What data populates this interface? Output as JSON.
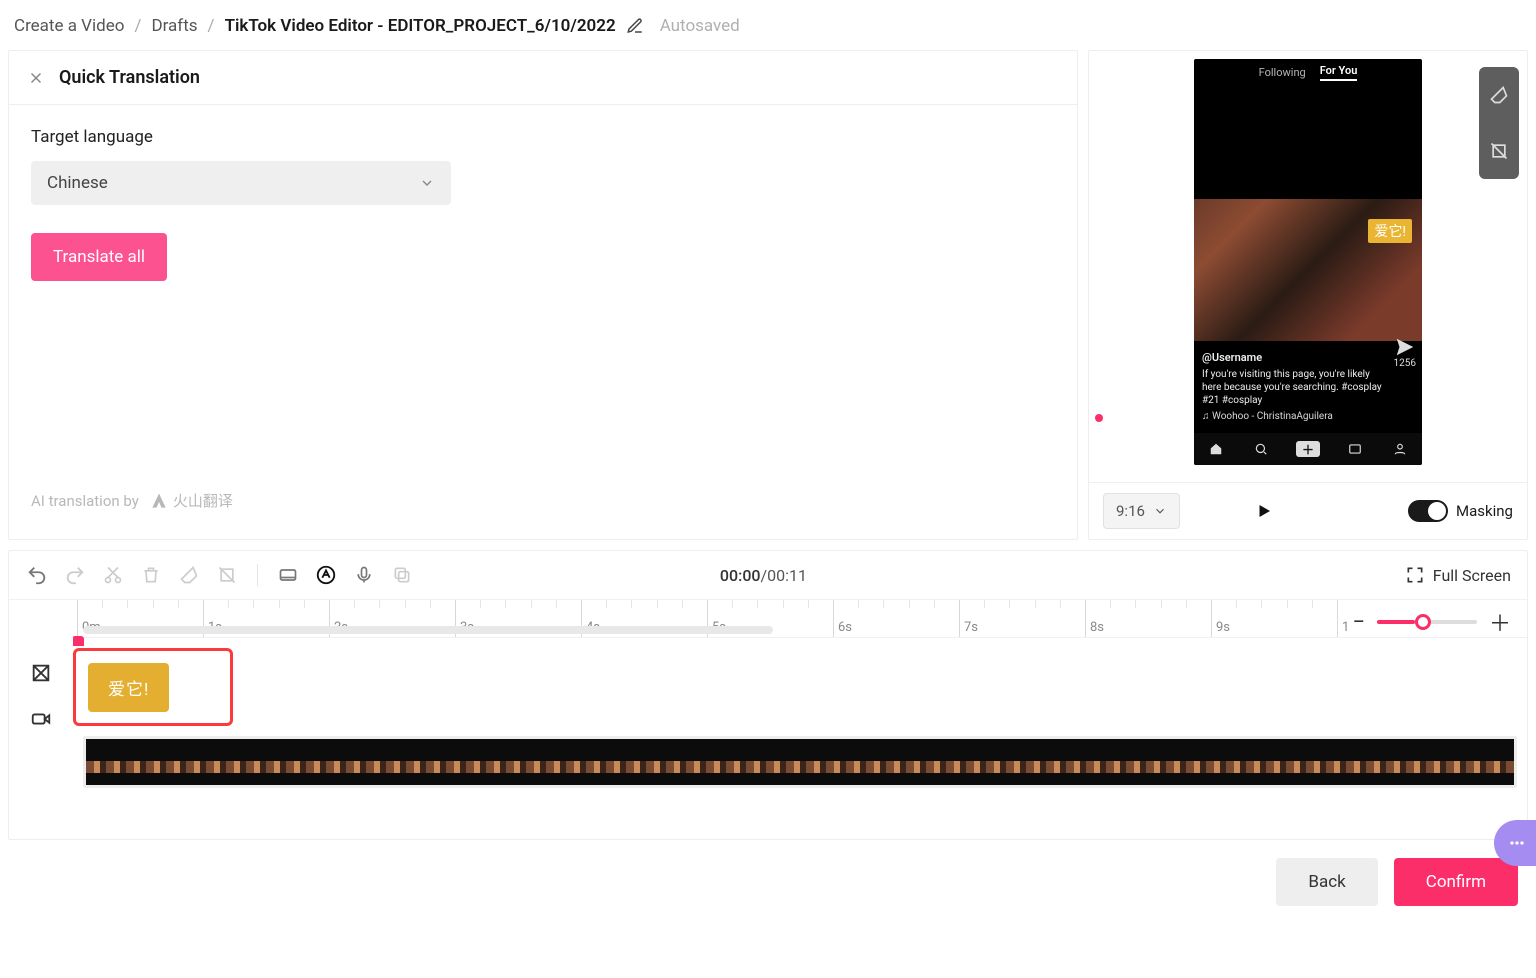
{
  "breadcrumb": {
    "root": "Create a Video",
    "drafts": "Drafts",
    "current": "TikTok Video Editor - EDITOR_PROJECT_6/10/2022",
    "autosaved": "Autosaved"
  },
  "panel": {
    "title": "Quick Translation",
    "target_label": "Target language",
    "target_value": "Chinese",
    "translate_btn": "Translate all",
    "attribution": "AI translation by",
    "attribution_brand": "火山翻译"
  },
  "preview": {
    "following": "Following",
    "foryou": "For You",
    "subtitle": "爱它!",
    "username": "@Username",
    "caption": "If you're visiting this page, you're likely here because you're searching. #cosplay #21 #cosplay",
    "audio": "♫ Woohoo - ChristinaAguilera",
    "share_count": "1256",
    "aspect": "9:16",
    "masking_label": "Masking"
  },
  "timeline": {
    "time_current": "00:00",
    "time_total": "00:11",
    "fullscreen": "Full Screen",
    "ticks": [
      "0m",
      "1s",
      "2s",
      "3s",
      "4s",
      "5s",
      "6s",
      "7s",
      "8s",
      "9s",
      "1"
    ],
    "clip_text": "爱它!"
  },
  "footer": {
    "back": "Back",
    "confirm": "Confirm"
  }
}
